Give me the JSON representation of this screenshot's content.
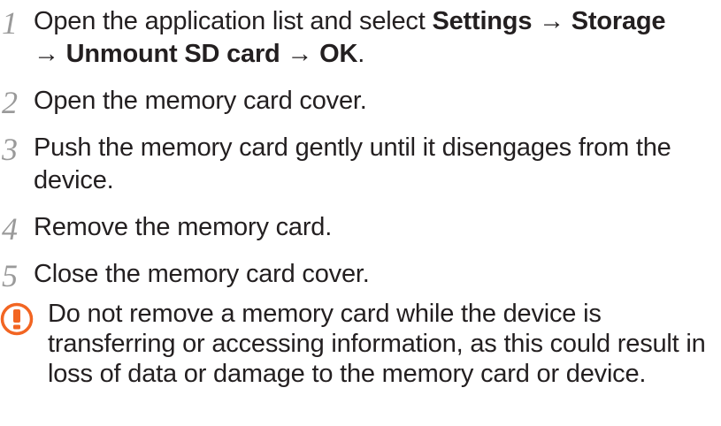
{
  "steps": [
    {
      "number": "1",
      "line1_text": "Open the application list and select ",
      "settings": "Settings",
      "arrow1": " → ",
      "storage": "Storage",
      "arrow2": "→ ",
      "unmount": "Unmount SD card",
      "arrow3": " → ",
      "ok": "OK",
      "period": "."
    },
    {
      "number": "2",
      "text": "Open the memory card cover."
    },
    {
      "number": "3",
      "text": "Push the memory card gently until it disengages from the device."
    },
    {
      "number": "4",
      "text": "Remove the memory card."
    },
    {
      "number": "5",
      "text": "Close the memory card cover."
    }
  ],
  "warning": {
    "icon": "caution-icon",
    "accent_color": "#f26522",
    "text": "Do not remove a memory card while the device is transferring or accessing information, as this could result in loss of data or damage to the memory card or device."
  }
}
